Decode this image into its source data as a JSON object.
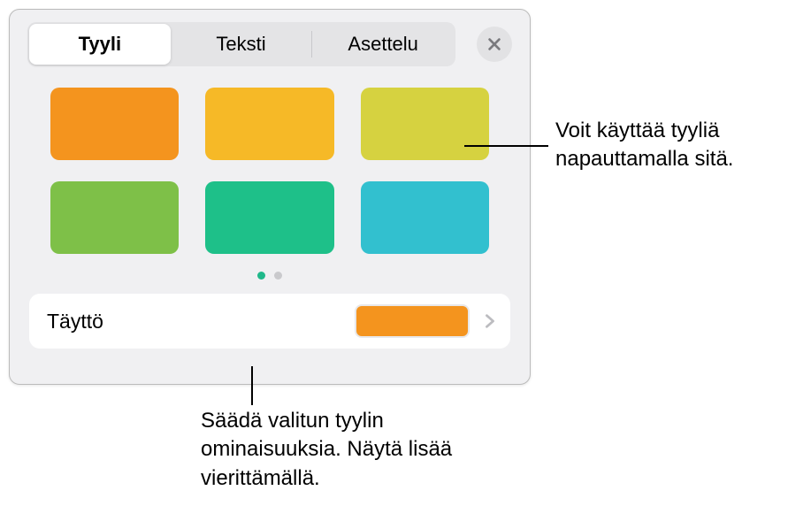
{
  "tabs": {
    "style": "Tyyli",
    "text": "Teksti",
    "layout": "Asettelu"
  },
  "swatches": [
    {
      "color": "#f4941e"
    },
    {
      "color": "#f6b927"
    },
    {
      "color": "#d6d240"
    },
    {
      "color": "#7ec048"
    },
    {
      "color": "#1ec089"
    },
    {
      "color": "#32c0cf"
    }
  ],
  "fill": {
    "label": "Täyttö",
    "color": "#f4941e"
  },
  "callouts": {
    "tap_style": "Voit käyttää tyyliä napauttamalla sitä.",
    "adjust_props": "Säädä valitun tyylin ominaisuuksia. Näytä lisää vierittämällä."
  }
}
